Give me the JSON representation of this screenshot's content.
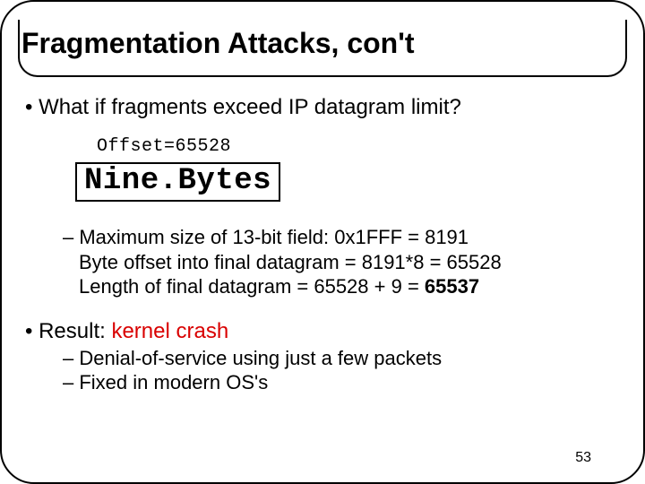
{
  "title": "Fragmentation Attacks, con't",
  "bullets": {
    "q1": "What if fragments exceed IP datagram limit?"
  },
  "offset_label": "Offset=65528",
  "nine_bytes": "Nine.Bytes",
  "maxsize": {
    "l1_prefix": "Maximum size of 13-bit field: 0x1FFF = 8191",
    "l2": "Byte offset into final datagram = 8191*8 = 65528",
    "l3_prefix": "Length of final datagram = 65528 + 9 = ",
    "l3_bold": "65537"
  },
  "result": {
    "prefix": "Result: ",
    "crash": "kernel crash",
    "sub1": "Denial-of-service using just a few packets",
    "sub2": "Fixed in modern OS's"
  },
  "page_number": "53"
}
